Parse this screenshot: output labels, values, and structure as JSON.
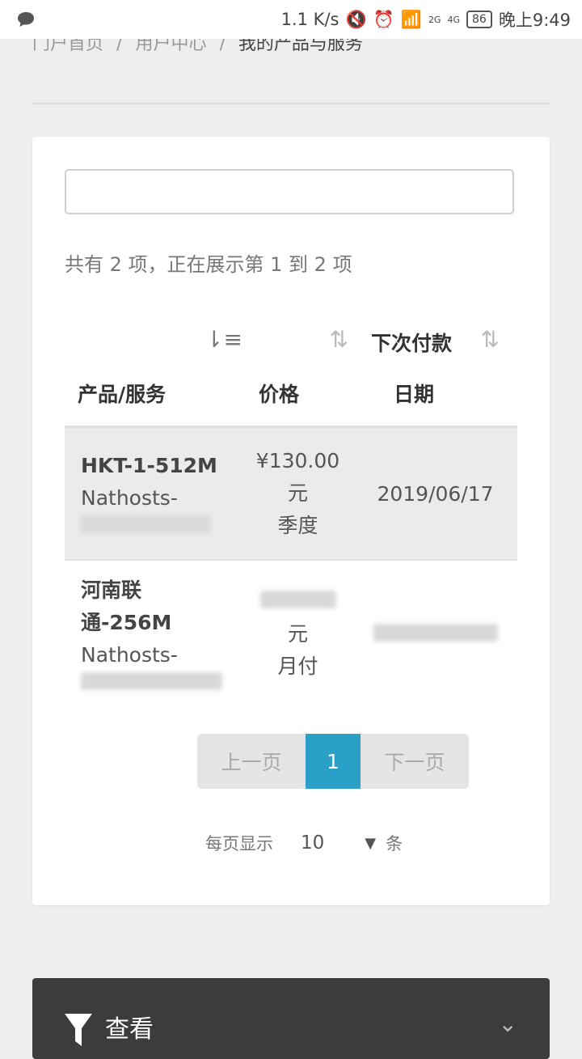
{
  "status_bar": {
    "speed": "1.1 K/s",
    "battery": "86",
    "time": "晚上9:49",
    "network_2g": "2G",
    "network_4g": "4G"
  },
  "breadcrumb": {
    "home": "门户首页",
    "user_center": "用户中心",
    "current": "我的产品与服务",
    "separator": "/"
  },
  "search": {
    "value": "",
    "placeholder": ""
  },
  "summary": "共有 2 项，正在展示第 1 到 2 项",
  "table": {
    "headers": {
      "product": "产品/服务",
      "price": "价格",
      "next_due_line1": "下次付款",
      "next_due_line2": "日期"
    },
    "rows": [
      {
        "name": "HKT-1-512M",
        "domain": "Nathosts-",
        "price": "¥130.00",
        "currency": "元",
        "cycle": "季度",
        "due": "2019/06/17"
      },
      {
        "name_line1": "河南联",
        "name_line2": "通-256M",
        "domain": "Nathosts-",
        "currency": "元",
        "cycle": "月付"
      }
    ]
  },
  "pagination": {
    "prev": "上一页",
    "current": "1",
    "next": "下一页"
  },
  "per_page": {
    "label": "每页显示",
    "value": "10",
    "unit": "条"
  },
  "filter": {
    "label": "查看"
  },
  "colors": {
    "accent": "#2aa0c8",
    "dark_bar": "#3c3c3c"
  }
}
